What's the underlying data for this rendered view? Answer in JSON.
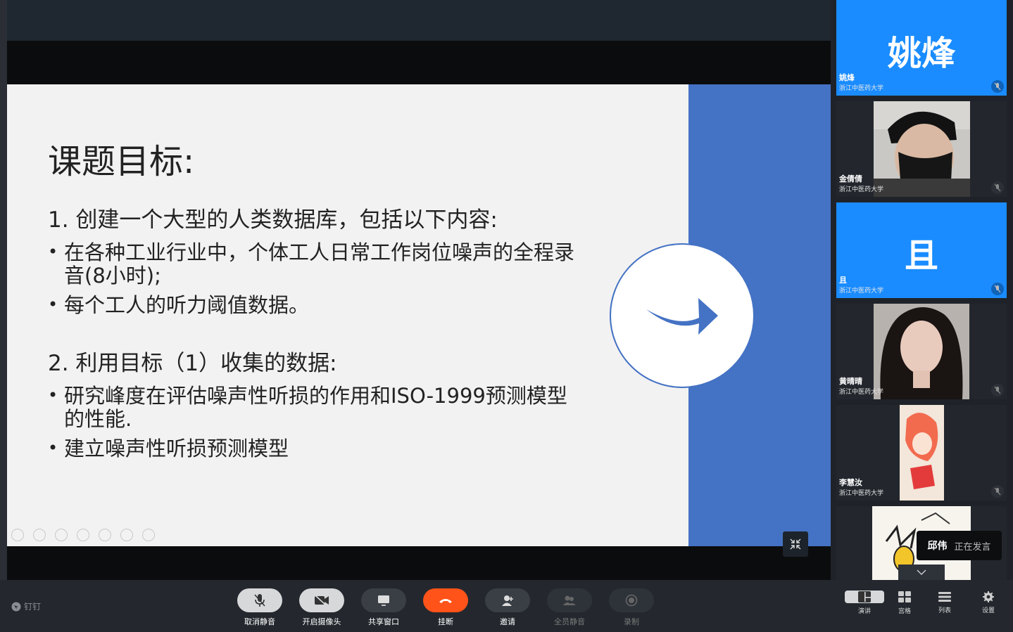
{
  "slide": {
    "title": "课题目标:",
    "point1": "1.  创建一个大型的人类数据库，包括以下内容:",
    "bullet1": "在各种工业行业中，个体工人日常工作岗位噪声的全程录音(8小时);",
    "bullet2": "每个工人的听力阈值数据。",
    "point2": "2.  利用目标（1）收集的数据:",
    "bullet3": "研究峰度在评估噪声性听损的作用和ISO-1999预测模型的性能.",
    "bullet4": "建立噪声性听损预测模型",
    "accent_color": "#4472c4"
  },
  "participants": [
    {
      "avatar_text": "姚烽",
      "name": "姚烽",
      "org": "浙江中医药大学",
      "type": "avatar"
    },
    {
      "avatar_text": "",
      "name": "金倩倩",
      "org": "浙江中医药大学",
      "type": "photo",
      "icon": "person-photo"
    },
    {
      "avatar_text": "且",
      "name": "且",
      "org": "浙江中医药大学",
      "type": "avatar"
    },
    {
      "avatar_text": "",
      "name": "黄晴晴",
      "org": "浙江中医药大学",
      "type": "photo",
      "icon": "person-photo"
    },
    {
      "avatar_text": "",
      "name": "李慧汝",
      "org": "浙江中医药大学",
      "type": "photo",
      "icon": "illustration-photo"
    },
    {
      "avatar_text": "",
      "name": "",
      "org": "",
      "type": "photo",
      "icon": "comic-photo"
    }
  ],
  "speaking": {
    "name": "邱伟",
    "status": "正在发言"
  },
  "brand": "钉钉",
  "controls": [
    {
      "label": "取消静音",
      "icon": "mic-icon"
    },
    {
      "label": "开启摄像头",
      "icon": "camera-icon"
    },
    {
      "label": "共享窗口",
      "icon": "screen-share-icon"
    },
    {
      "label": "挂断",
      "icon": "hangup-icon"
    },
    {
      "label": "邀请",
      "icon": "invite-icon"
    },
    {
      "label": "全员静音",
      "icon": "mute-all-icon"
    },
    {
      "label": "录制",
      "icon": "record-icon"
    }
  ],
  "views": [
    {
      "label": "演讲",
      "icon": "speaker-view-icon",
      "active": true
    },
    {
      "label": "宫格",
      "icon": "grid-view-icon",
      "active": false
    },
    {
      "label": "列表",
      "icon": "list-view-icon",
      "active": false
    },
    {
      "label": "设置",
      "icon": "gear-icon",
      "active": false
    }
  ],
  "colors": {
    "hangup": "#ff5319",
    "tile_blue": "#1a8cff"
  }
}
